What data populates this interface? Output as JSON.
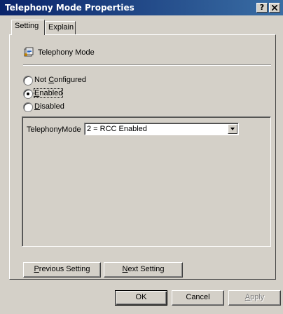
{
  "window": {
    "title": "Telephony Mode Properties",
    "help_button": "?",
    "close_button": "X"
  },
  "tabs": [
    {
      "label": "Setting",
      "active": true
    },
    {
      "label": "Explain",
      "active": false
    }
  ],
  "policy": {
    "icon": "policy-setting-icon",
    "name": "Telephony Mode"
  },
  "state_options": [
    {
      "label_pre": "Not ",
      "accel": "C",
      "label_post": "onfigured",
      "selected": false
    },
    {
      "label_pre": "",
      "accel": "E",
      "label_post": "nabled",
      "selected": true
    },
    {
      "label_pre": "",
      "accel": "D",
      "label_post": "isabled",
      "selected": false
    }
  ],
  "option": {
    "label": "TelephonyMode",
    "selected_value": "2 = RCC Enabled"
  },
  "nav": {
    "prev": {
      "accel": "P",
      "rest": "revious Setting"
    },
    "next": {
      "accel": "N",
      "rest": "ext Setting"
    }
  },
  "dialog_buttons": {
    "ok": "OK",
    "cancel": "Cancel",
    "apply_accel": "A",
    "apply_rest": "pply"
  }
}
